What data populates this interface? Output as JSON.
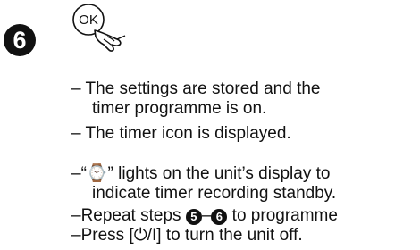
{
  "step": {
    "number": "6",
    "button_label": "OK"
  },
  "items": {
    "stored_1": "– The settings are stored and the",
    "stored_2": "timer programme is on.",
    "icon_displayed": "– The timer icon is displayed.",
    "lights_1": "–“⌚” lights on the unit’s display to",
    "lights_2": "indicate timer recording standby.",
    "repeat_prefix": "–Repeat steps ",
    "repeat_from": "5",
    "repeat_dash": "–",
    "repeat_to": "6",
    "repeat_suffix": " to programme",
    "press": "–Press [⏻/I] to turn the unit off."
  }
}
